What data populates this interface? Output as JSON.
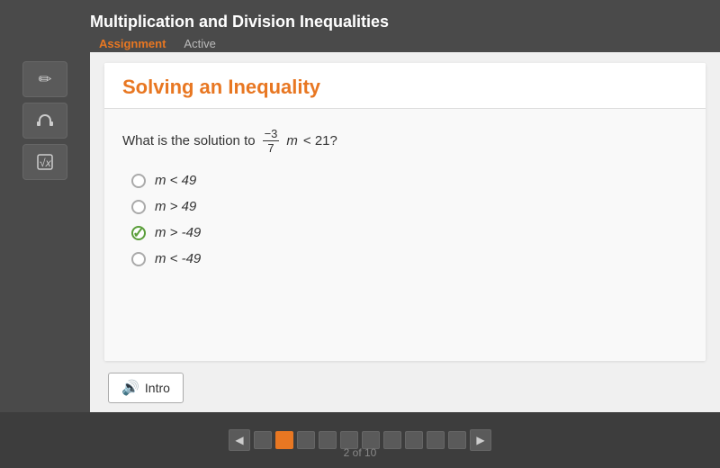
{
  "header": {
    "title": "Multiplication and Division Inequalities",
    "tabs": [
      {
        "label": "Assignment",
        "state": "active"
      },
      {
        "label": "Active",
        "state": "inactive"
      }
    ]
  },
  "sidebar": {
    "buttons": [
      {
        "icon": "✏️",
        "name": "pencil"
      },
      {
        "icon": "🎧",
        "name": "headphones"
      },
      {
        "icon": "√",
        "name": "calculator"
      }
    ]
  },
  "question": {
    "title": "Solving an Inequality",
    "text_before": "What is the solution to ",
    "fraction_numerator": "−3",
    "fraction_denominator": "7",
    "variable": "m",
    "inequality": "< 21?",
    "choices": [
      {
        "id": "a",
        "text": "m < 49",
        "selected": false,
        "correct": false
      },
      {
        "id": "b",
        "text": "m > 49",
        "selected": false,
        "correct": false
      },
      {
        "id": "c",
        "text": "m > -49",
        "selected": true,
        "correct": true
      },
      {
        "id": "d",
        "text": "m < -49",
        "selected": false,
        "correct": false
      }
    ]
  },
  "intro_button": {
    "label": "Intro"
  },
  "nav": {
    "current_page": "2",
    "total_pages": "10",
    "page_info": "2 of 10",
    "dots": [
      1,
      2,
      3,
      4,
      5,
      6,
      7,
      8,
      9,
      10
    ],
    "active_dot": 2
  }
}
